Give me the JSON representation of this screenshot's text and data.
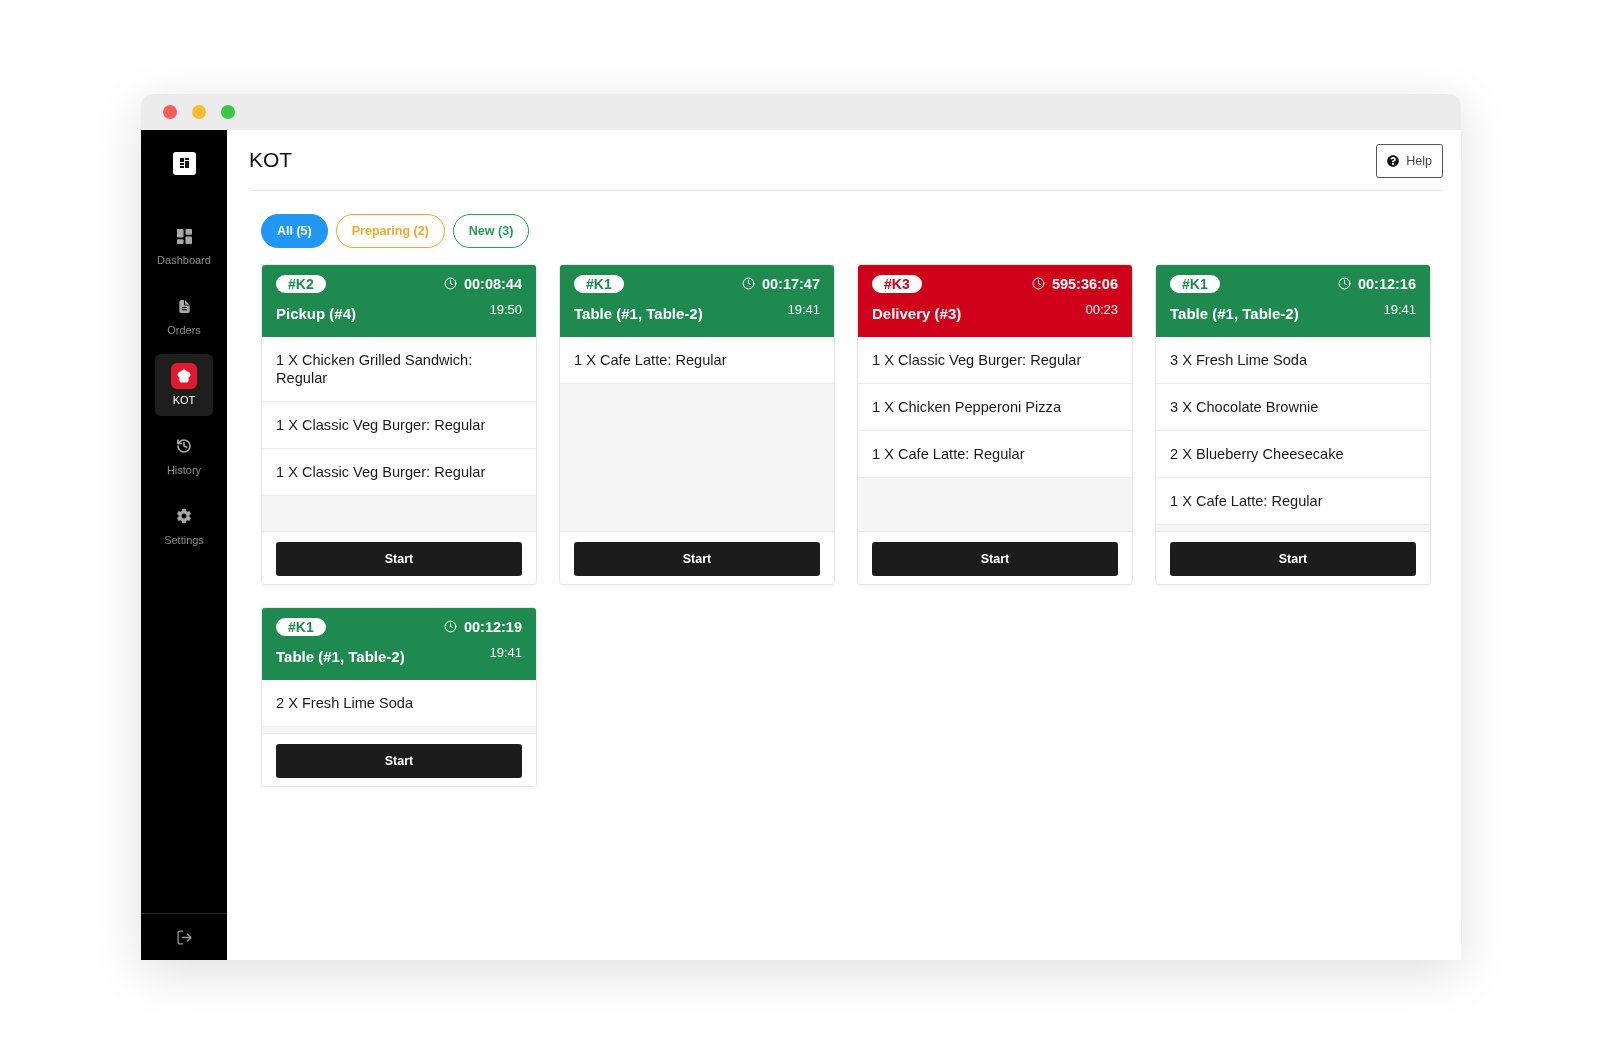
{
  "sidebar": {
    "items": [
      {
        "label": "Dashboard",
        "selected": false
      },
      {
        "label": "Orders",
        "selected": false
      },
      {
        "label": "KOT",
        "selected": true
      },
      {
        "label": "History",
        "selected": false
      },
      {
        "label": "Settings",
        "selected": false
      }
    ]
  },
  "header": {
    "title": "KOT",
    "help_button": "Help"
  },
  "filters": [
    {
      "label": "All (5)",
      "selected": true,
      "color": "#2196f3"
    },
    {
      "label": "Preparing (2)",
      "selected": false,
      "color": "#f2a531"
    },
    {
      "label": "New (3)",
      "selected": false,
      "color": "#2a9a5a"
    }
  ],
  "cards": [
    {
      "ticket": "#K2",
      "timer": "00:08:44",
      "type": "Pickup (#4)",
      "time": "19:50",
      "color": "#1f8a4f",
      "items": [
        "1 X Chicken Grilled Sandwich: Regular",
        "1 X Classic Veg Burger: Regular",
        "1 X Classic Veg Burger: Regular"
      ],
      "button": "Start"
    },
    {
      "ticket": "#K1",
      "timer": "00:17:47",
      "type": "Table (#1, Table-2)",
      "time": "19:41",
      "color": "#1f8a4f",
      "items": [
        "1 X Cafe Latte: Regular"
      ],
      "button": "Start"
    },
    {
      "ticket": "#K3",
      "timer": "595:36:06",
      "type": "Delivery (#3)",
      "time": "00:23",
      "color": "#d0021b",
      "items": [
        "1 X Classic Veg Burger: Regular",
        "1 X Chicken Pepperoni Pizza",
        "1 X Cafe Latte: Regular"
      ],
      "button": "Start"
    },
    {
      "ticket": "#K1",
      "timer": "00:12:16",
      "type": "Table (#1, Table-2)",
      "time": "19:41",
      "color": "#1f8a4f",
      "items": [
        "3 X Fresh Lime Soda",
        "3 X Chocolate Brownie",
        "2 X Blueberry Cheesecake",
        "1 X Cafe Latte: Regular"
      ],
      "button": "Start"
    },
    {
      "ticket": "#K1",
      "timer": "00:12:19",
      "type": "Table (#1, Table-2)",
      "time": "19:41",
      "color": "#1f8a4f",
      "items": [
        "2 X Fresh Lime Soda"
      ],
      "button": "Start"
    }
  ]
}
